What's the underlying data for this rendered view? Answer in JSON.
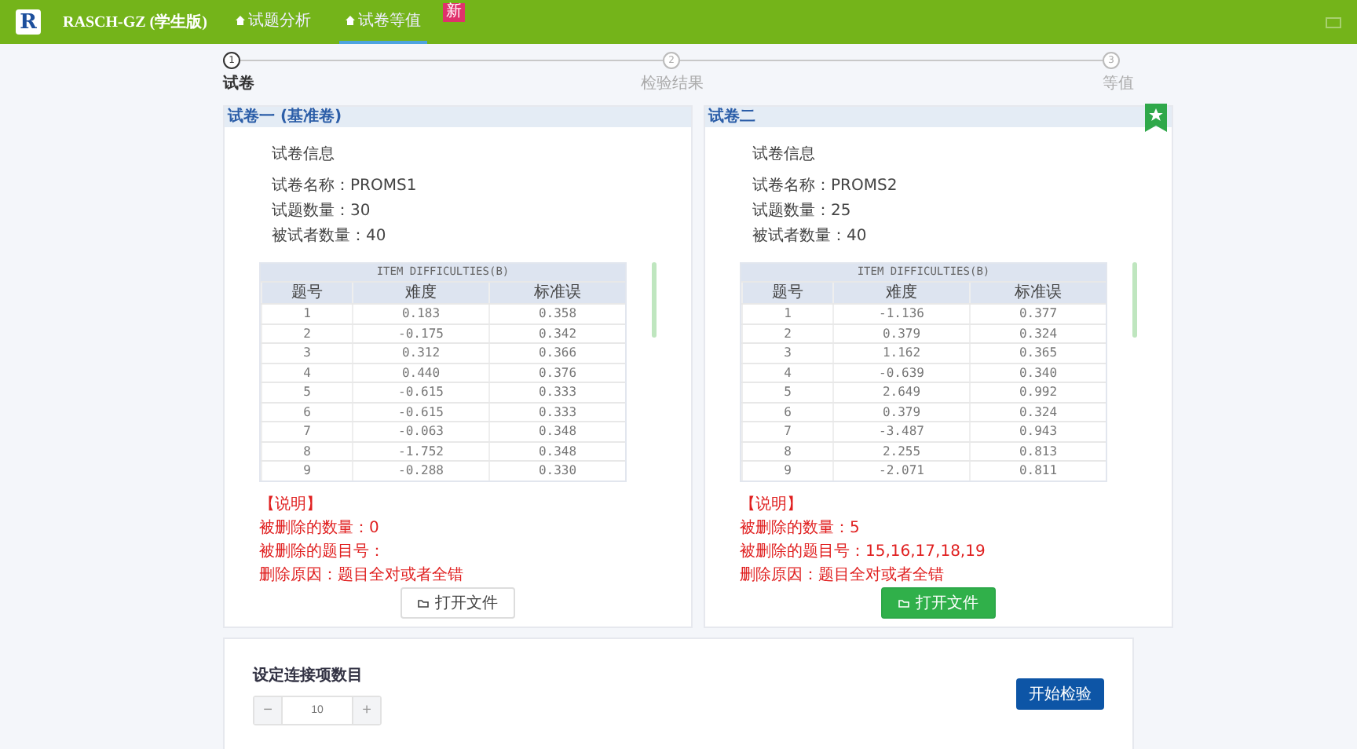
{
  "app": {
    "logo": "R",
    "title": "RASCH-GZ (学生版)"
  },
  "nav": [
    {
      "label": "试题分析",
      "selected": false
    },
    {
      "label": "试卷等值",
      "selected": true,
      "badge": "新"
    }
  ],
  "steps": [
    {
      "number": "1",
      "label": "试卷",
      "active": true
    },
    {
      "number": "2",
      "label": "检验结果",
      "active": false
    },
    {
      "number": "3",
      "label": "等值",
      "active": false
    }
  ],
  "papers": [
    {
      "title": "试卷一 (基准卷)",
      "starred": false,
      "info_title": "试卷信息",
      "info": [
        "试卷名称：PROMS1",
        "试题数量：30",
        "被试者数量：40"
      ],
      "table_caption": "ITEM DIFFICULTIES(B)",
      "columns": [
        "题号",
        "难度",
        "标准误"
      ],
      "rows": [
        [
          "1",
          "0.183",
          "0.358"
        ],
        [
          "2",
          "-0.175",
          "0.342"
        ],
        [
          "3",
          "0.312",
          "0.366"
        ],
        [
          "4",
          "0.440",
          "0.376"
        ],
        [
          "5",
          "-0.615",
          "0.333"
        ],
        [
          "6",
          "-0.615",
          "0.333"
        ],
        [
          "7",
          "-0.063",
          "0.348"
        ],
        [
          "8",
          "-1.752",
          "0.348"
        ],
        [
          "9",
          "-0.288",
          "0.330"
        ]
      ],
      "note_title": "【说明】",
      "notes": [
        "被删除的数量：0",
        "被删除的题目号：",
        "删除原因：题目全对或者全错"
      ],
      "button": {
        "label": "打开文件",
        "primary": false
      }
    },
    {
      "title": "试卷二",
      "starred": true,
      "info_title": "试卷信息",
      "info": [
        "试卷名称：PROMS2",
        "试题数量：25",
        "被试者数量：40"
      ],
      "table_caption": "ITEM DIFFICULTIES(B)",
      "columns": [
        "题号",
        "难度",
        "标准误"
      ],
      "rows": [
        [
          "1",
          "-1.136",
          "0.377"
        ],
        [
          "2",
          "0.379",
          "0.324"
        ],
        [
          "3",
          "1.162",
          "0.365"
        ],
        [
          "4",
          "-0.639",
          "0.340"
        ],
        [
          "5",
          "2.649",
          "0.992"
        ],
        [
          "6",
          "0.379",
          "0.324"
        ],
        [
          "7",
          "-3.487",
          "0.943"
        ],
        [
          "8",
          "2.255",
          "0.813"
        ],
        [
          "9",
          "-2.071",
          "0.811"
        ]
      ],
      "note_title": "【说明】",
      "notes": [
        "被删除的数量：5",
        "被删除的题目号：15,16,17,18,19",
        "删除原因：题目全对或者全错"
      ],
      "button": {
        "label": "打开文件",
        "primary": true
      }
    }
  ],
  "link_setting": {
    "label": "设定连接项数目",
    "value": "10",
    "minus": "−",
    "plus": "+"
  },
  "start_button": "开始检验"
}
